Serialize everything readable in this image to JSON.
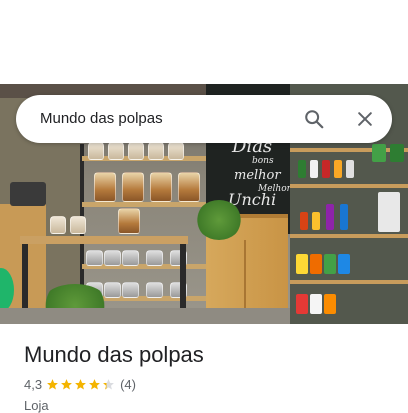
{
  "search": {
    "query": "Mundo das polpas",
    "search_icon": "search-icon",
    "close_icon": "close-icon"
  },
  "photo": {
    "chalkboard_lines": [
      "Dias",
      "bons",
      "melhor",
      "Melhor",
      "Unchi"
    ]
  },
  "place": {
    "title": "Mundo das polpas",
    "rating": "4,3",
    "rating_fraction": 0.86,
    "review_count": "(4)",
    "category": "Loja"
  },
  "colors": {
    "star": "#f4b400",
    "star_empty": "#dadce0",
    "icon": "#5f6368",
    "text_primary": "#202124",
    "text_secondary": "#5f6368"
  }
}
